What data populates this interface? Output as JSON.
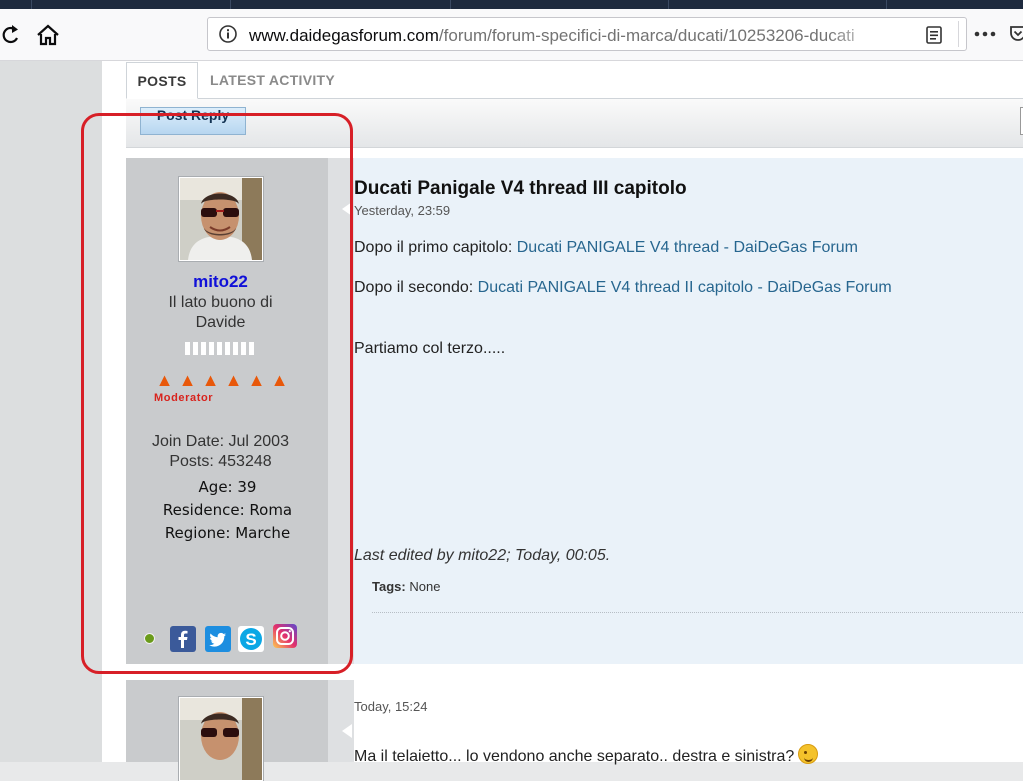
{
  "browser": {
    "url_domain": "www.daidegasforum.com",
    "url_path": "/forum/forum-specifici-di-marca/ducati/10253206-ducati"
  },
  "tabs": [
    "POSTS",
    "LATEST ACTIVITY"
  ],
  "toolbar": {
    "post_reply": "Post Reply"
  },
  "post1": {
    "user": {
      "name": "mito22",
      "title_line1": "Il lato buono di",
      "title_line2": "Davide",
      "rank": "Moderator",
      "join_date": "Join Date: Jul 2003",
      "posts": "Posts: 453248",
      "age": "Age: 39",
      "residence": "Residence: Roma",
      "regione": "Regione: Marche",
      "social_icons": [
        "facebook-icon",
        "twitter-icon",
        "skype-icon",
        "instagram-icon"
      ]
    },
    "title": "Ducati Panigale V4 thread III capitolo",
    "date": "Yesterday, 23:59",
    "line1_prefix": "Dopo il primo capitolo: ",
    "line1_link": "Ducati PANIGALE V4 thread - DaiDeGas Forum",
    "line2_prefix": "Dopo il secondo: ",
    "line2_link": "Ducati PANIGALE V4 thread II capitolo - DaiDeGas Forum",
    "line3": "Partiamo col terzo.....",
    "last_edited": "Last edited by mito22; Today, 00:05.",
    "tags_label": "Tags:",
    "tags_value": "None"
  },
  "post2": {
    "date": "Today, 15:24",
    "text": "Ma il telaietto... lo vendono anche separato.. destra e sinistra?"
  },
  "colors": {
    "highlight": "#d71f27",
    "username": "#1010d8",
    "link": "#27668f"
  }
}
